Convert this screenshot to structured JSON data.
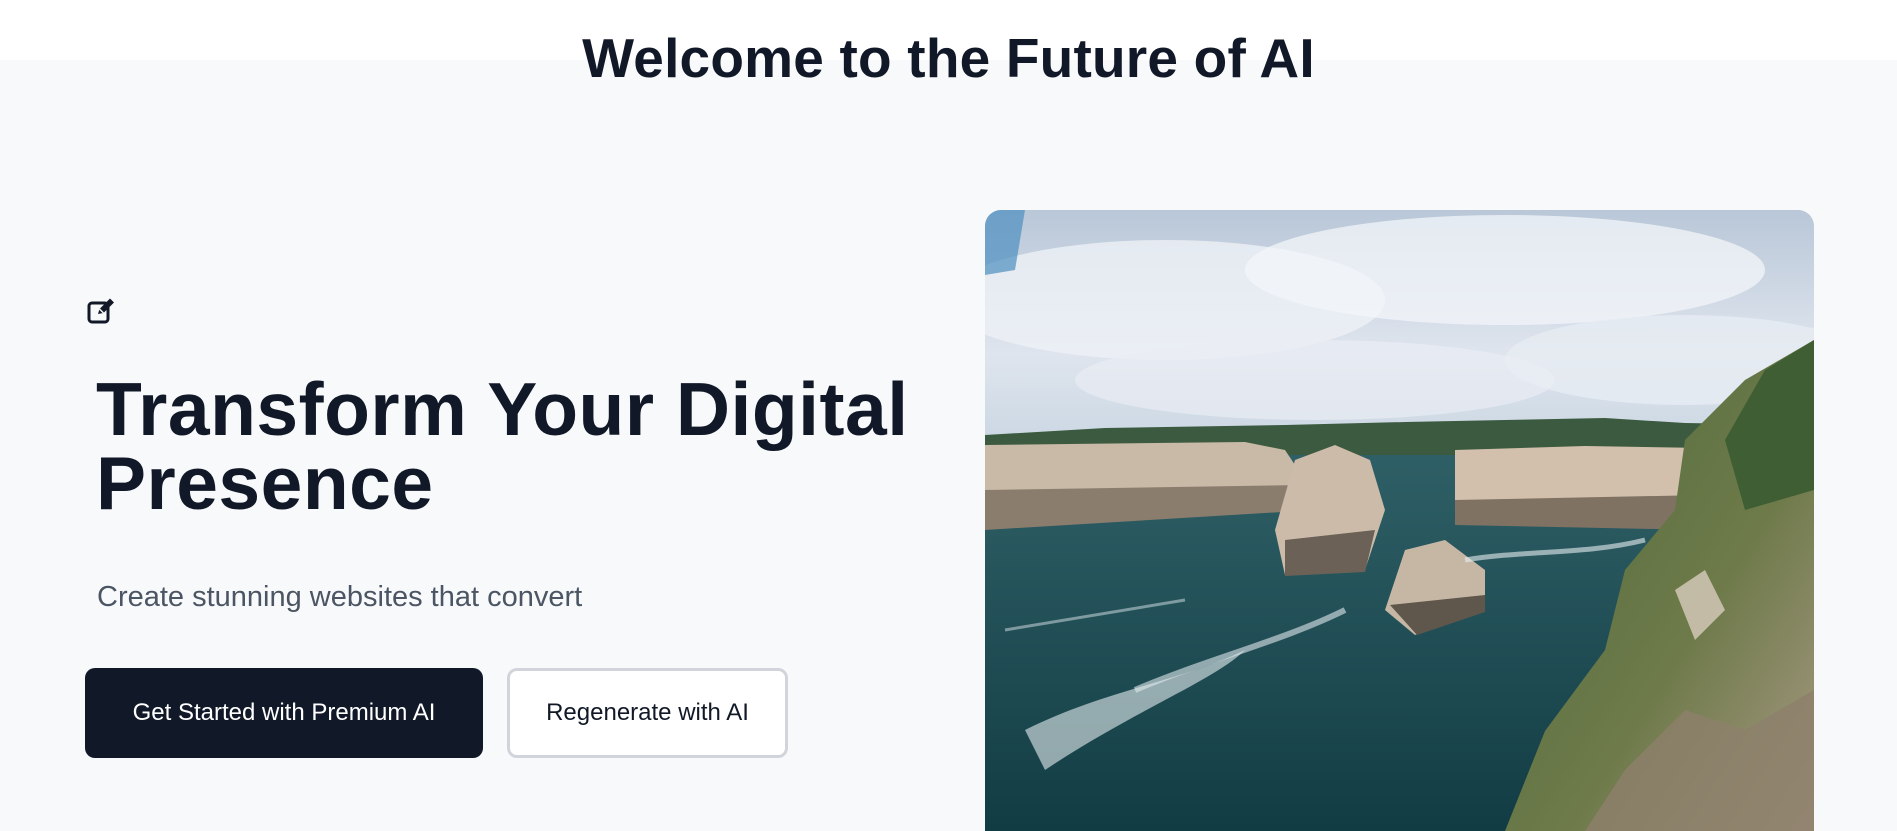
{
  "header": {
    "title": "Welcome to the Future of AI"
  },
  "hero": {
    "edit_icon": "edit-pencil-icon",
    "heading": "Transform Your Digital Presence",
    "subheading": "Create stunning websites that convert",
    "primary_button_label": "Get Started with Premium AI",
    "secondary_button_label": "Regenerate with AI",
    "image_alt": "Coastal sea cliffs and rock formations under a cloudy sky"
  },
  "colors": {
    "text_dark": "#111827",
    "text_muted": "#4b5563",
    "hero_background": "#f8f9fb",
    "button_primary_bg": "#111827",
    "button_secondary_border": "#d1d5db"
  }
}
